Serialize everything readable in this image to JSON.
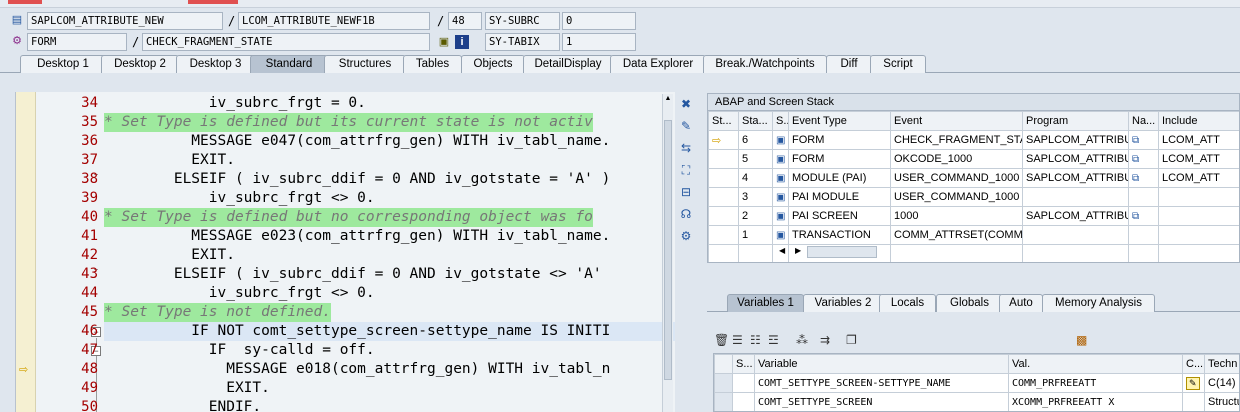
{
  "header": {
    "program": "SAPLCOM_ATTRIBUTE_NEW",
    "include": "LCOM_ATTRIBUTE_NEWF1B",
    "line": "48",
    "event_type": "FORM",
    "event": "CHECK_FRAGMENT_STATE",
    "sys_fields": [
      {
        "name": "SY-SUBRC",
        "value": "0"
      },
      {
        "name": "SY-TABIX",
        "value": "1"
      }
    ],
    "separator": "/"
  },
  "tabs": [
    {
      "label": "Desktop 1"
    },
    {
      "label": "Desktop 2"
    },
    {
      "label": "Desktop 3"
    },
    {
      "label": "Standard",
      "active": true
    },
    {
      "label": "Structures"
    },
    {
      "label": "Tables"
    },
    {
      "label": "Objects"
    },
    {
      "label": "DetailDisplay"
    },
    {
      "label": "Data Explorer"
    },
    {
      "label": "Break./Watchpoints"
    },
    {
      "label": "Diff"
    },
    {
      "label": "Script"
    }
  ],
  "code_lines": [
    {
      "num": "34",
      "text": "            iv_subrc_frgt = 0."
    },
    {
      "num": "35",
      "text": "* Set Type is defined but its current state is not activ",
      "comment": true
    },
    {
      "num": "36",
      "text": "          MESSAGE e047(com_attrfrg_gen) WITH iv_tabl_name."
    },
    {
      "num": "37",
      "text": "          EXIT."
    },
    {
      "num": "38",
      "text": "        ELSEIF ( iv_subrc_ddif = 0 AND iv_gotstate = 'A' )"
    },
    {
      "num": "39",
      "text": "            iv_subrc_frgt <> 0."
    },
    {
      "num": "40",
      "text": "* Set Type is defined but no corresponding object was fo",
      "comment": true
    },
    {
      "num": "41",
      "text": "          MESSAGE e023(com_attrfrg_gen) WITH iv_tabl_name."
    },
    {
      "num": "42",
      "text": "          EXIT."
    },
    {
      "num": "43",
      "text": "        ELSEIF ( iv_subrc_ddif = 0 AND iv_gotstate <> 'A'"
    },
    {
      "num": "44",
      "text": "            iv_subrc_frgt <> 0."
    },
    {
      "num": "45",
      "text": "* Set Type is not defined.",
      "comment": true
    },
    {
      "num": "46",
      "text": "          IF NOT comt_settype_screen-settype_name IS INITI"
    },
    {
      "num": "47",
      "text": "            IF  sy-calld = off."
    },
    {
      "num": "48",
      "text": "              MESSAGE e018(com_attrfrg_gen) WITH iv_tabl_n"
    },
    {
      "num": "49",
      "text": "              EXIT."
    },
    {
      "num": "50",
      "text": "            ENDIF."
    }
  ],
  "stack": {
    "title": "ABAP and Screen Stack",
    "columns": [
      "St...",
      "Sta...",
      "S...",
      "Event Type",
      "Event",
      "Program",
      "Na...",
      "Include"
    ],
    "rows": [
      {
        "level": "6",
        "type": "FORM",
        "event": "CHECK_FRAGMENT_STA...",
        "program": "SAPLCOM_ATTRIBUTE_...",
        "include": "LCOM_ATT",
        "current": true,
        "nav": true
      },
      {
        "level": "5",
        "type": "FORM",
        "event": "OKCODE_1000",
        "program": "SAPLCOM_ATTRIBUTE_...",
        "include": "LCOM_ATT",
        "nav": true
      },
      {
        "level": "4",
        "type": "MODULE (PAI)",
        "event": "USER_COMMAND_1000",
        "program": "SAPLCOM_ATTRIBUTE_...",
        "include": "LCOM_ATT",
        "nav": true
      },
      {
        "level": "3",
        "type": "PAI MODULE",
        "event": "USER_COMMAND_1000",
        "program": "",
        "include": ""
      },
      {
        "level": "2",
        "type": "PAI SCREEN",
        "event": "1000",
        "program": "SAPLCOM_ATTRIBUTE_...",
        "include": "",
        "nav": true
      },
      {
        "level": "1",
        "type": "TRANSACTION",
        "event": "COMM_ATTRSET(COMM...",
        "program": "",
        "include": ""
      }
    ]
  },
  "var_tabs": [
    {
      "label": "Variables 1",
      "active": true
    },
    {
      "label": "Variables 2"
    },
    {
      "label": "Locals"
    },
    {
      "label": "Globals"
    },
    {
      "label": "Auto"
    },
    {
      "label": "Memory Analysis"
    }
  ],
  "variables": {
    "columns": [
      "S...",
      "Variable",
      "Val.",
      "C...",
      "Techn"
    ],
    "rows": [
      {
        "name": "COMT_SETTYPE_SCREEN-SETTYPE_NAME",
        "value": "COMM_PRFREEATT",
        "tech": "C(14)"
      },
      {
        "name": "COMT_SETTYPE_SCREEN",
        "value": "XCOMM_PRFREEATT  X",
        "tech": "Structu"
      }
    ]
  },
  "icons": {
    "program": "program-icon",
    "event": "event-icon",
    "stack_row": "event-type-icon",
    "current": "current-line-arrow-icon"
  }
}
